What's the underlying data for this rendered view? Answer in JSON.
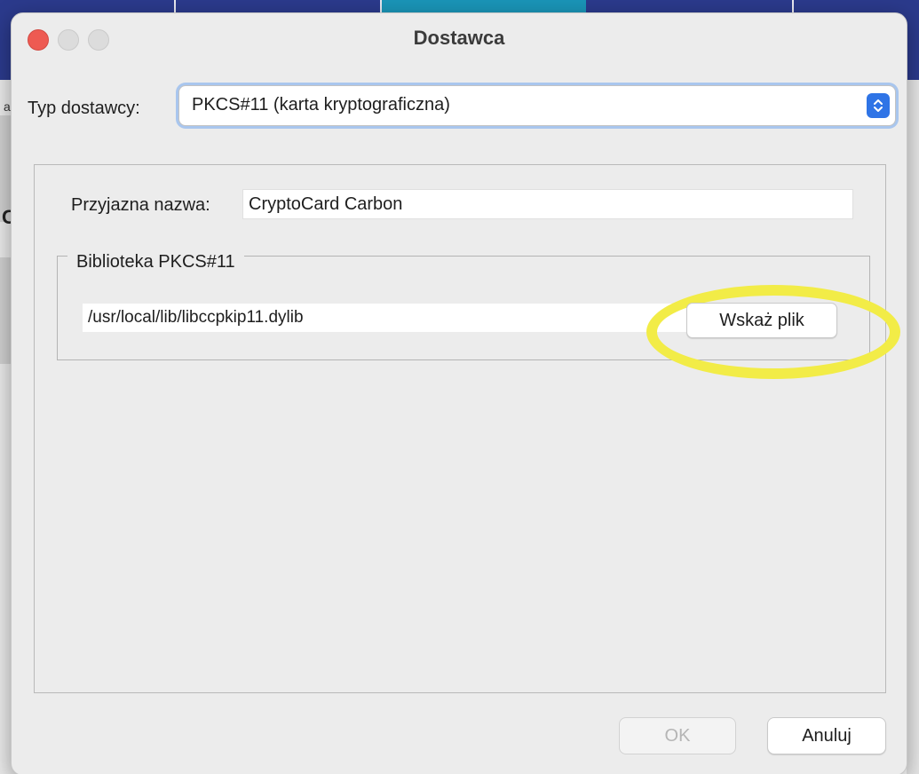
{
  "window": {
    "title": "Dostawca"
  },
  "provider_type": {
    "label": "Typ dostawcy:",
    "selected": "PKCS#11 (karta kryptograficzna)"
  },
  "friendly_name": {
    "label": "Przyjazna nazwa:",
    "value": "CryptoCard Carbon"
  },
  "library": {
    "group_title": "Biblioteka PKCS#11",
    "path": "/usr/local/lib/libccpkip11.dylib",
    "browse_label": "Wskaż plik"
  },
  "buttons": {
    "ok_label": "OK",
    "cancel_label": "Anuluj"
  },
  "background_app": {
    "left_letter_small": "a",
    "left_letter_large": "C"
  },
  "colors": {
    "accent_blue": "#2f74e6",
    "highlight_yellow": "#f2ec47",
    "close_red": "#ee5a52",
    "app_header": "#2b3a8c"
  },
  "icons": {
    "select_arrows": "chevron-up-down-icon"
  }
}
